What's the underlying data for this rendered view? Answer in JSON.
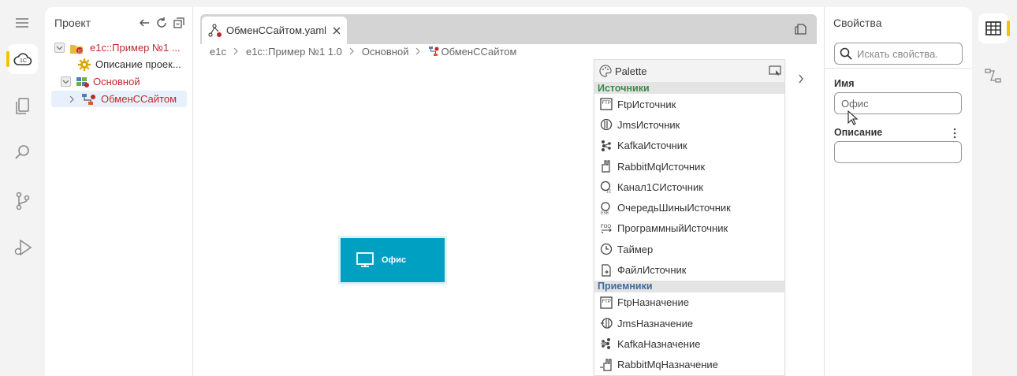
{
  "project": {
    "title": "Проект",
    "tree": [
      {
        "label": "e1c::Пример №1 ...",
        "icon": "project-icon"
      },
      {
        "label": "Описание проек...",
        "icon": "gear-icon"
      },
      {
        "label": "Основной",
        "icon": "module-icon"
      },
      {
        "label": "ОбменССайтом",
        "icon": "flow-icon"
      }
    ]
  },
  "editor": {
    "tab_label": "ОбменССайтом.yaml",
    "breadcrumb": [
      "e1c",
      "e1c::Пример №1 1.0",
      "Основной",
      "ОбменССайтом"
    ],
    "node_label": "Офис"
  },
  "palette": {
    "title": "Palette",
    "sections": [
      {
        "title": "Источники",
        "color": "#3a8a4a",
        "items": [
          "FtpИсточник",
          "JmsИсточник",
          "KafkaИсточник",
          "RabbitMqИсточник",
          "Канал1СИсточник",
          "ОчередьШиныИсточник",
          "ПрограммныйИсточник",
          "Таймер",
          "ФайлИсточник"
        ]
      },
      {
        "title": "Приемники",
        "color": "#3d6a9e",
        "items": [
          "FtpНазначение",
          "JmsНазначение",
          "KafkaНазначение",
          "RabbitMqНазначение"
        ]
      }
    ]
  },
  "properties": {
    "title": "Свойства",
    "search_placeholder": "Искать свойства.",
    "name_label": "Имя",
    "name_value": "Офис",
    "description_label": "Описание",
    "description_value": ""
  },
  "colors": {
    "accent": "#f5c200",
    "node": "#00a0c2",
    "error": "#c0282d"
  }
}
